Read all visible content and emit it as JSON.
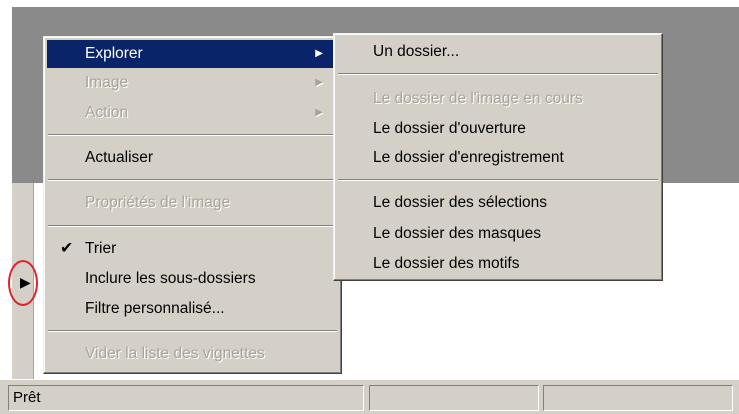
{
  "main_menu": {
    "items": [
      {
        "label": "Explorer",
        "has_submenu": true,
        "state": "selected"
      },
      {
        "label": "Image",
        "has_submenu": true,
        "state": "disabled"
      },
      {
        "label": "Action",
        "has_submenu": true,
        "state": "disabled"
      },
      {
        "label": "Actualiser",
        "state": "enabled"
      },
      {
        "label": "Propriétés de l'image",
        "state": "disabled"
      },
      {
        "label": "Trier",
        "checked": true,
        "state": "enabled"
      },
      {
        "label": "Inclure les sous-dossiers",
        "state": "enabled"
      },
      {
        "label": "Filtre personnalisé...",
        "state": "enabled"
      },
      {
        "label": "Vider la liste des vignettes",
        "state": "disabled"
      }
    ],
    "check_glyph": "✔",
    "submenu_arrow_glyph": "▶"
  },
  "sub_menu": {
    "items": [
      {
        "label": "Un dossier...",
        "state": "enabled"
      },
      {
        "label": "Le dossier de l'image en cours",
        "state": "disabled"
      },
      {
        "label": "Le dossier d'ouverture",
        "state": "enabled"
      },
      {
        "label": "Le dossier d'enregistrement",
        "state": "enabled"
      },
      {
        "label": "Le dossier des sélections",
        "state": "enabled"
      },
      {
        "label": "Le dossier des masques",
        "state": "enabled"
      },
      {
        "label": "Le dossier des motifs",
        "state": "enabled"
      }
    ]
  },
  "statusbar": {
    "text": "Prêt"
  },
  "left_panel": {
    "toggle_glyph": "▶"
  },
  "colors": {
    "menu_bg": "#d4d0c8",
    "highlight": "#0a246a",
    "annotation_circle": "#e0202a"
  }
}
